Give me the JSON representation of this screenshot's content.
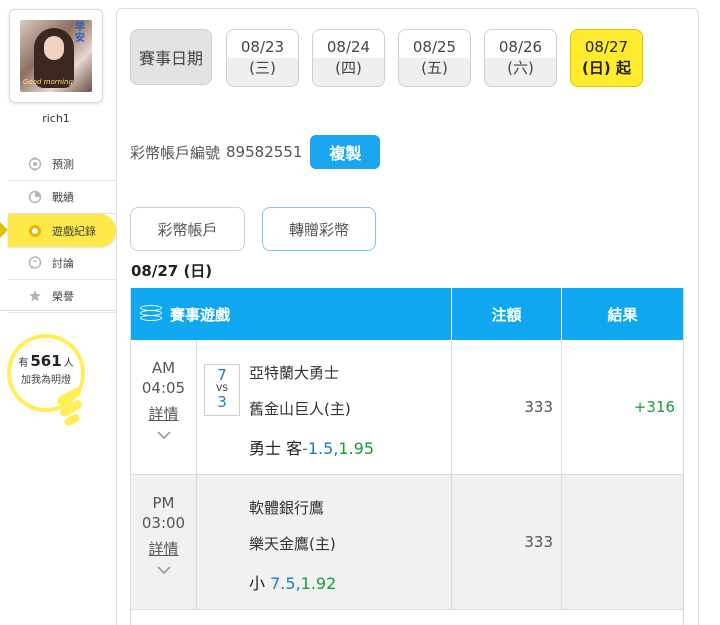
{
  "sidebar": {
    "avatar": {
      "morning_text": "早安",
      "greeting_text": "Good morning"
    },
    "username": "rich1",
    "menu": [
      {
        "label": "預測",
        "icon": "target-icon",
        "active": false
      },
      {
        "label": "戰績",
        "icon": "chart-icon",
        "active": false
      },
      {
        "label": "遊戲紀錄",
        "icon": "ring-icon",
        "active": true
      },
      {
        "label": "討論",
        "icon": "chat-icon",
        "active": false
      },
      {
        "label": "榮譽",
        "icon": "star-icon",
        "active": false
      }
    ],
    "fans": {
      "prefix": "有",
      "count": "561",
      "suffix": "人",
      "subtitle": "加我為明燈"
    }
  },
  "date_tabs": {
    "label": "賽事日期",
    "dates": [
      {
        "date": "08/23",
        "day": "(三)"
      },
      {
        "date": "08/24",
        "day": "(四)"
      },
      {
        "date": "08/25",
        "day": "(五)"
      },
      {
        "date": "08/26",
        "day": "(六)"
      },
      {
        "date": "08/27",
        "day": "(日) 起",
        "active": true
      }
    ]
  },
  "account": {
    "label": "彩幣帳戶編號",
    "number": "89582551",
    "copy_label": "複製"
  },
  "actions": {
    "account_btn": "彩幣帳戶",
    "gift_btn": "轉贈彩幣"
  },
  "day_title": "08/27 (日)",
  "table": {
    "headers": {
      "game": "賽事遊戲",
      "stake": "注額",
      "result": "結果"
    },
    "rows": [
      {
        "period": "AM",
        "time": "04:05",
        "detail": "詳情",
        "score_away": "7",
        "vs": "VS",
        "score_home": "3",
        "team_away": "亞特蘭大勇士",
        "team_home": "舊金山巨人(主)",
        "pick_team": "勇士 客",
        "pick_line": "-1.5",
        "pick_sep": ",",
        "pick_odds": "1.95",
        "stake": "333",
        "result": "+316"
      },
      {
        "period": "PM",
        "time": "03:00",
        "detail": "詳情",
        "team_away": "軟體銀行鷹",
        "team_home": "樂天金鷹(主)",
        "pick_team": "小",
        "pick_line": "7.5",
        "pick_sep": ",",
        "pick_odds": "1.92",
        "stake": "333",
        "result": ""
      }
    ]
  },
  "colors": {
    "accent_blue": "#0fa7ef",
    "highlight_yellow": "#ffeb2e",
    "win_green": "#1a9a3a"
  }
}
